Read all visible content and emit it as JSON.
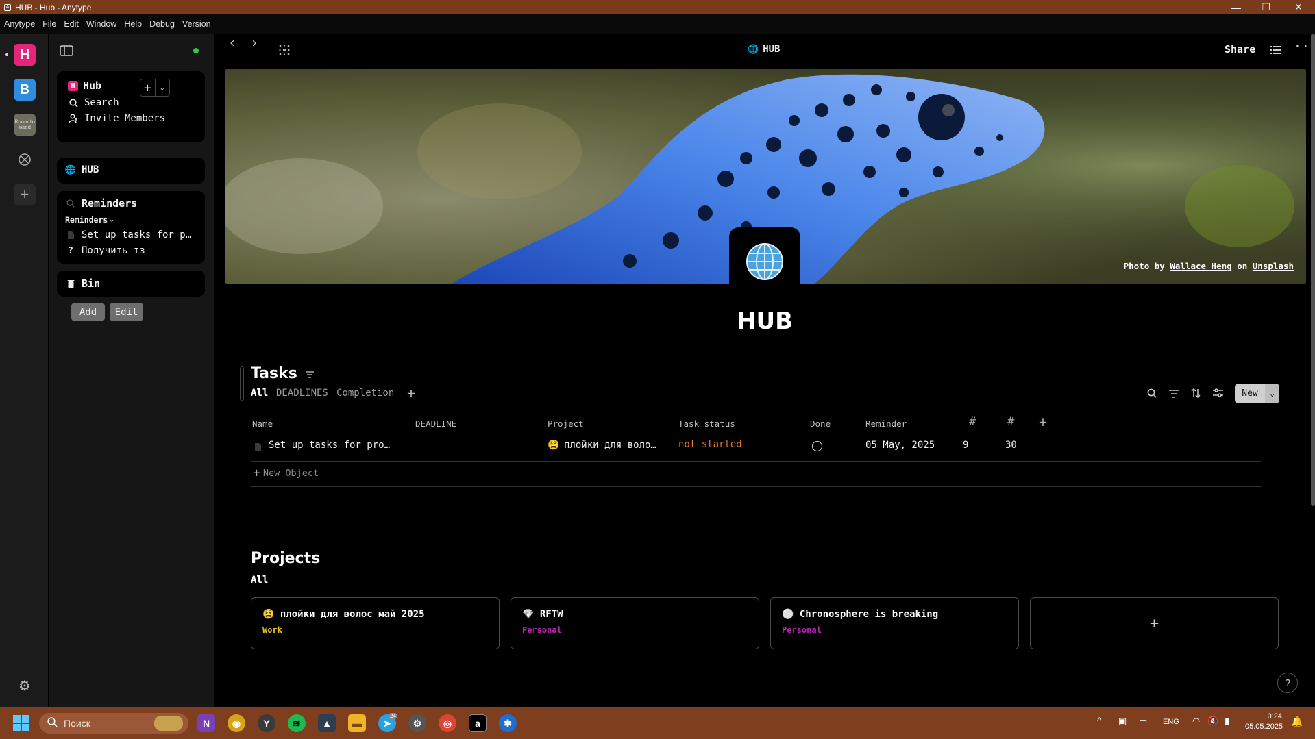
{
  "window": {
    "title": "HUB - Hub - Anytype",
    "controls": {
      "minimize": "—",
      "maximize": "❐",
      "close": "✕"
    }
  },
  "menu": [
    "Anytype",
    "File",
    "Edit",
    "Window",
    "Help",
    "Debug",
    "Version"
  ],
  "spaces": [
    {
      "label": "H",
      "color": "#e5257a"
    },
    {
      "label": "B",
      "color": "#2f8ddf"
    },
    {
      "label": "Room to Wind",
      "color": "#6d6d5f"
    }
  ],
  "sidebar": {
    "space_name": "Hub",
    "space_badge": "H",
    "search_label": "Search",
    "invite_label": "Invite Members",
    "pinned_page": "HUB",
    "widget_title": "Reminders",
    "widget_view": "Reminders",
    "widget_items": [
      "Set up tasks for p…",
      "Получить тз"
    ],
    "bin_label": "Bin",
    "add_label": "Add",
    "edit_label": "Edit",
    "status_color": "#2ecc40"
  },
  "topbar": {
    "page_title": "HUB",
    "share_label": "Share"
  },
  "cover": {
    "credit_prefix": "Photo by",
    "credit_author": "Wallace Heng",
    "credit_mid": "on",
    "credit_source": "Unsplash"
  },
  "page": {
    "title": "HUB"
  },
  "tasks": {
    "title": "Tasks",
    "views": [
      "All",
      "DEADLINES",
      "Completion"
    ],
    "new_label": "New",
    "columns": [
      "Name",
      "DEADLINE",
      "Project",
      "Task status",
      "Done",
      "Reminder",
      "#",
      "#"
    ],
    "rows": [
      {
        "name": "Set up tasks for pro…",
        "deadline": "",
        "project": "плойки для воло…",
        "status": "not started",
        "done": false,
        "reminder": "05 May, 2025",
        "num1": "9",
        "num2": "30"
      }
    ],
    "new_object_label": "New Object",
    "status_color": "#e8742f"
  },
  "projects": {
    "title": "Projects",
    "view": "All",
    "cards": [
      {
        "name": "плойки для волос май 2025",
        "tag": "Work",
        "tag_color": "#e8c02a",
        "icon": "😫"
      },
      {
        "name": "RFTW",
        "tag": "Personal",
        "tag_color": "#c026b8",
        "icon": "💎"
      },
      {
        "name": "Chronosphere is breaking",
        "tag": "Personal",
        "tag_color": "#c026b8",
        "icon": "⚪"
      }
    ]
  },
  "help_label": "?",
  "taskbar": {
    "search_placeholder": "Поиск",
    "language": "ENG",
    "time": "0:24",
    "date": "05.05.2025",
    "telegram_badge": "24"
  }
}
